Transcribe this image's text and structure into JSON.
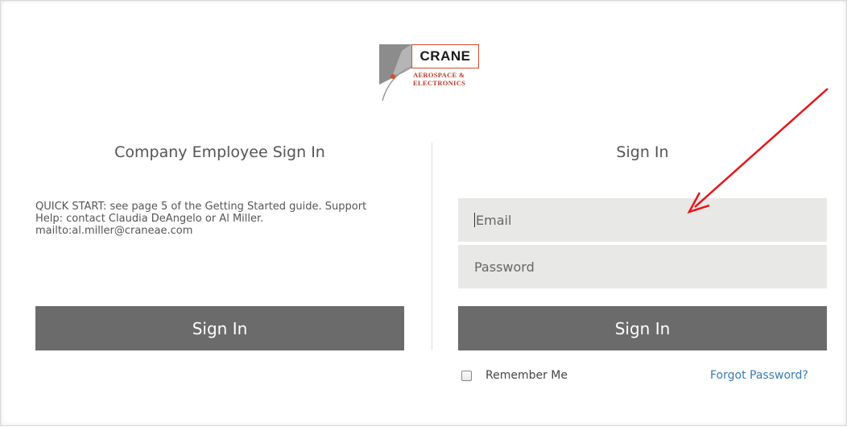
{
  "logo": {
    "brand": "CRANE",
    "line1": "AEROSPACE &",
    "line2": "ELECTRONICS"
  },
  "left_panel": {
    "title": "Company Employee Sign In",
    "quick_start_lines": [
      "QUICK START: see page 5 of the Getting Started guide. Support",
      "Help: contact Claudia DeAngelo or Al Miller.",
      "mailto:al.miller@craneae.com"
    ],
    "sign_in_label": "Sign In"
  },
  "right_panel": {
    "title": "Sign In",
    "email_placeholder": "Email",
    "password_placeholder": "Password",
    "sign_in_label": "Sign In",
    "remember_me_label": "Remember Me",
    "forgot_password_label": "Forgot Password?"
  },
  "colors": {
    "button": "#6b6b6b",
    "field_bg": "#e8e8e6",
    "link": "#3a7ab8",
    "logo_accent": "#d94b2b",
    "arrow": "#e8161b"
  }
}
